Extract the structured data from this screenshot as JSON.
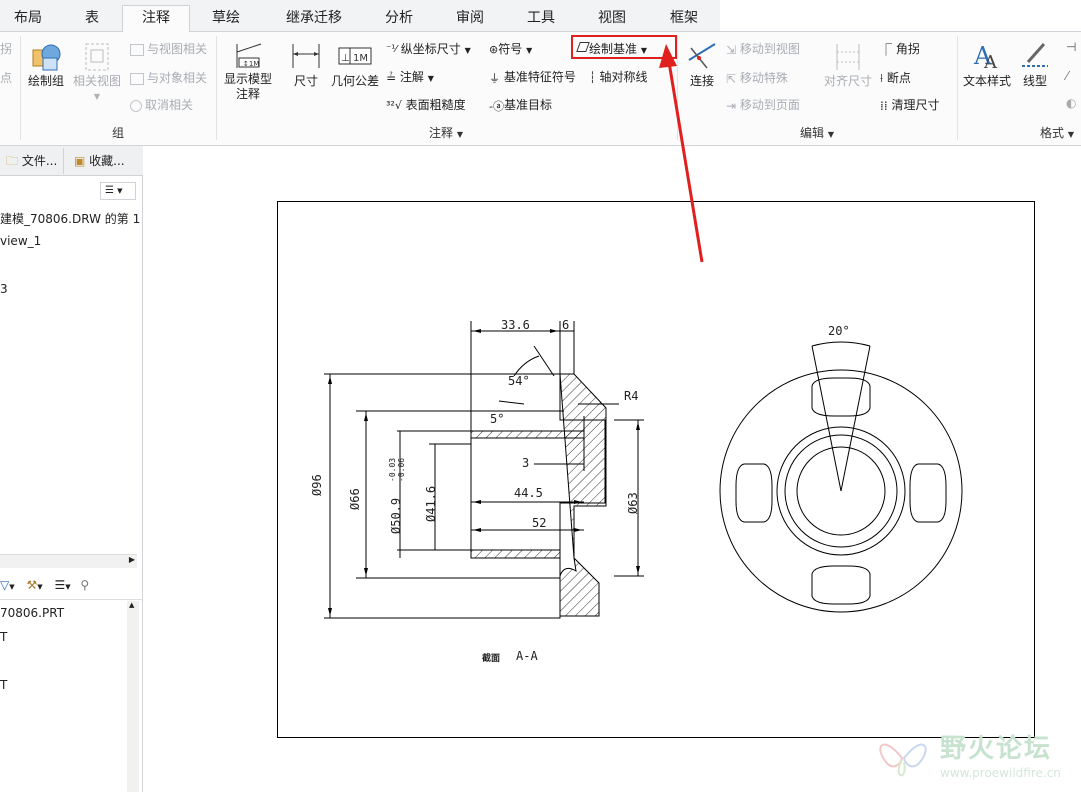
{
  "tabs": [
    "布局",
    "表",
    "注释",
    "草绘",
    "继承迁移",
    "分析",
    "审阅",
    "工具",
    "视图",
    "框架"
  ],
  "active_tab": "注释",
  "ribbon": {
    "partial_left": {
      "top": "拐",
      "mid": "点"
    },
    "group_zu": {
      "draw_group": "绘制组",
      "related_view": "相关视图",
      "view_related": "与视图相关",
      "object_related": "与对象相关",
      "cancel_related": "取消相关",
      "footer": "组"
    },
    "group_annotation": {
      "show_model_1": "显示模型",
      "show_model_2": "注释",
      "dimension": "尺寸",
      "gtol": "几何公差",
      "ordinate": "纵坐标尺寸",
      "note": "注解",
      "surface_finish": "表面粗糙度",
      "symbol": "符号",
      "datum_feature": "基准特征符号",
      "datum_target": "基准目标",
      "draw_datum": "绘制基准",
      "axis_sym": "轴对称线",
      "footer": "注释"
    },
    "group_edit": {
      "connect": "连接",
      "move_to_view": "移动到视图",
      "move_special": "移动特殊",
      "move_to_page": "移动到页面",
      "align_dim": "对齐尺寸",
      "corner": "角拐",
      "breakpoint": "断点",
      "clean_dim": "清理尺寸",
      "footer": "编辑"
    },
    "group_format": {
      "text_style": "文本样式",
      "line_type": "线型",
      "footer": "格式"
    }
  },
  "left_pane": {
    "tab_files": "文件...",
    "tab_favorites": "收藏...",
    "tree_top": [
      "建模_70806.DRW 的第 1",
      "view_1",
      "3"
    ],
    "tree_bottom": [
      "70806.PRT",
      "T",
      "T"
    ]
  },
  "drawing": {
    "dims": {
      "d33_6": "33.6",
      "d6": "6",
      "a54": "54°",
      "a5": "5°",
      "r4": "R4",
      "d3": "3",
      "d44_5": "44.5",
      "d52": "52",
      "dia96": "Ø96",
      "dia66": "Ø66",
      "dia50_9": "Ø50.9",
      "tol_up": "-0.03",
      "tol_dn": "-0.06",
      "dia41_6": "Ø41.6",
      "dia63": "Ø63",
      "a20": "20°"
    },
    "section_label": "截面",
    "section_name": "A-A"
  },
  "watermark": {
    "title": "野火论坛",
    "url": "www.proewildfire.cn"
  },
  "colors": {
    "highlight_red": "#e0201e",
    "accent_blue": "#2f6db5",
    "ribbon_bg": "#fbfbfb"
  }
}
